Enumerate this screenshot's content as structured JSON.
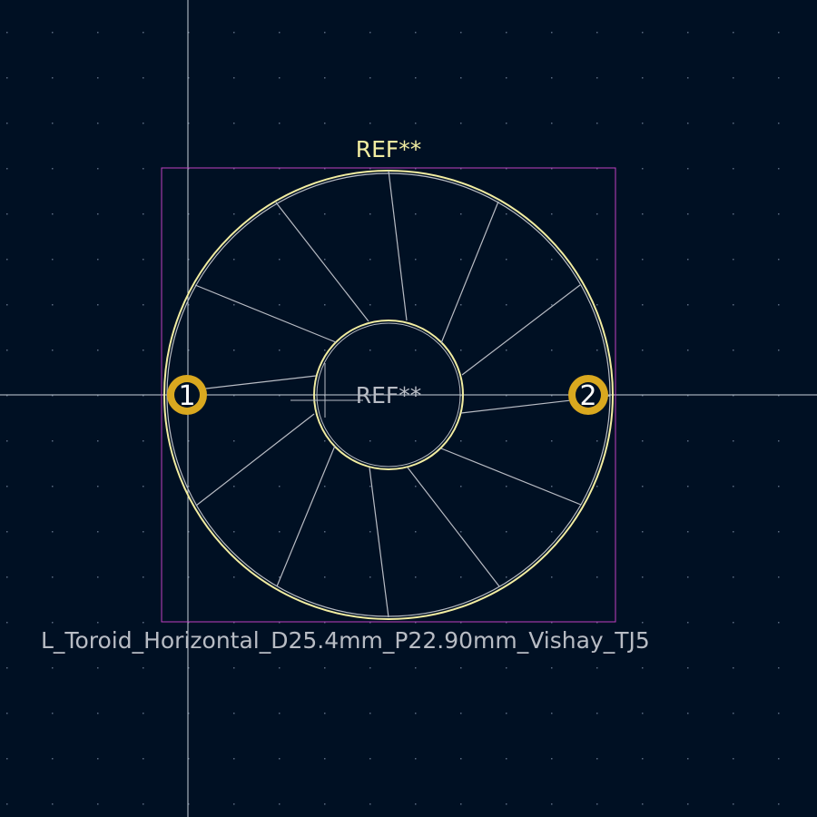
{
  "footprint": {
    "name": "L_Toroid_Horizontal_D25.4mm_P22.90mm_Vishay_TJ5",
    "reference_silk": "REF**",
    "reference_fab": "REF**",
    "pads": [
      {
        "number": "1"
      },
      {
        "number": "2"
      }
    ]
  },
  "colors": {
    "background": "#001023",
    "grid_dot": "#5a6a80",
    "crosshair": "#c8d0d8",
    "courtyard": "#c040c0",
    "silkscreen": "#f2eda1",
    "fab": "#b8bcc4",
    "pad": "#d9a81f",
    "pad_number": "#ffffff"
  }
}
